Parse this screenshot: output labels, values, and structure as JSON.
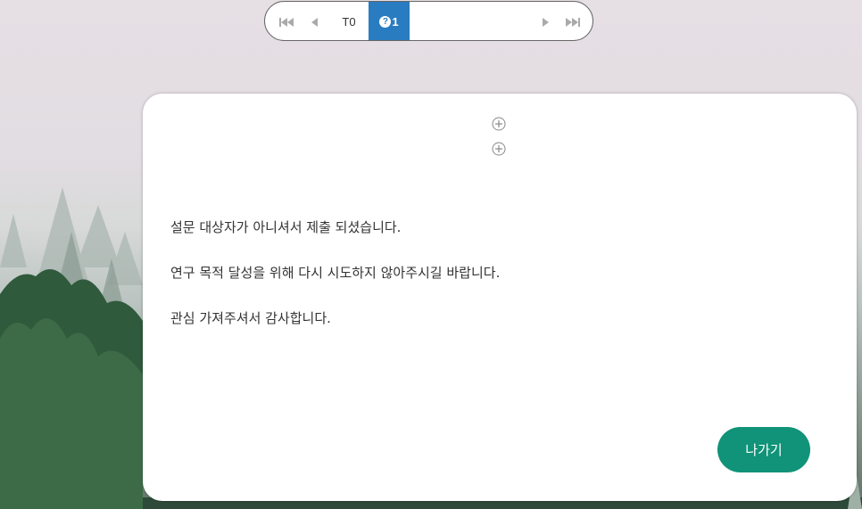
{
  "nav": {
    "first_icon": "skip-first-icon",
    "prev_icon": "prev-icon",
    "t0_label": "T0",
    "q1_label": "1",
    "q1_icon": "question-circle-icon",
    "next_icon": "next-icon",
    "last_icon": "skip-last-icon"
  },
  "card": {
    "expand_icons": [
      "plus-circle-icon",
      "plus-circle-icon"
    ],
    "messages": [
      "설문 대상자가 아니셔서 제출 되셨습니다.",
      "연구 목적 달성을 위해 다시 시도하지 않아주시길 바랍니다.",
      "관심 가져주셔서 감사합니다."
    ],
    "exit_label": "나가기"
  },
  "colors": {
    "accent_blue": "#2a7cc0",
    "exit_green": "#109378"
  }
}
